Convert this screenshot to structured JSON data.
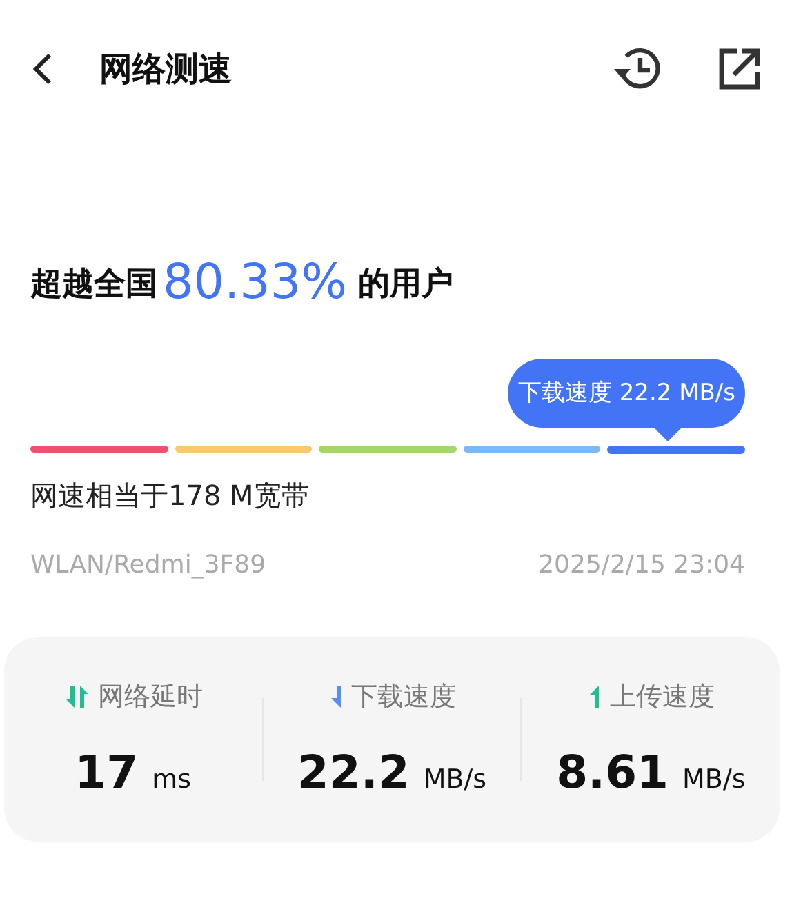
{
  "header": {
    "title": "网络测速"
  },
  "headline": {
    "prefix": "超越全国",
    "highlight": "80.33%",
    "suffix": "的用户"
  },
  "tooltip": {
    "text": "下载速度 22.2 MB/s"
  },
  "speed_scale": [
    {
      "color": "#f0506e",
      "selected": false
    },
    {
      "color": "#f9c96b",
      "selected": false
    },
    {
      "color": "#a6d66b",
      "selected": false
    },
    {
      "color": "#7ab8f8",
      "selected": false
    },
    {
      "color": "#4274f5",
      "selected": true
    }
  ],
  "equivalent": "网速相当于178 M宽带",
  "network": "WLAN/Redmi_3F89",
  "timestamp": "2025/2/15 23:04",
  "stats": [
    {
      "kind": "latency",
      "label": "网络延时",
      "value": "17",
      "unit": "ms"
    },
    {
      "kind": "download",
      "label": "下载速度",
      "value": "22.2",
      "unit": "MB/s"
    },
    {
      "kind": "upload",
      "label": "上传速度",
      "value": "8.61",
      "unit": "MB/s"
    }
  ]
}
